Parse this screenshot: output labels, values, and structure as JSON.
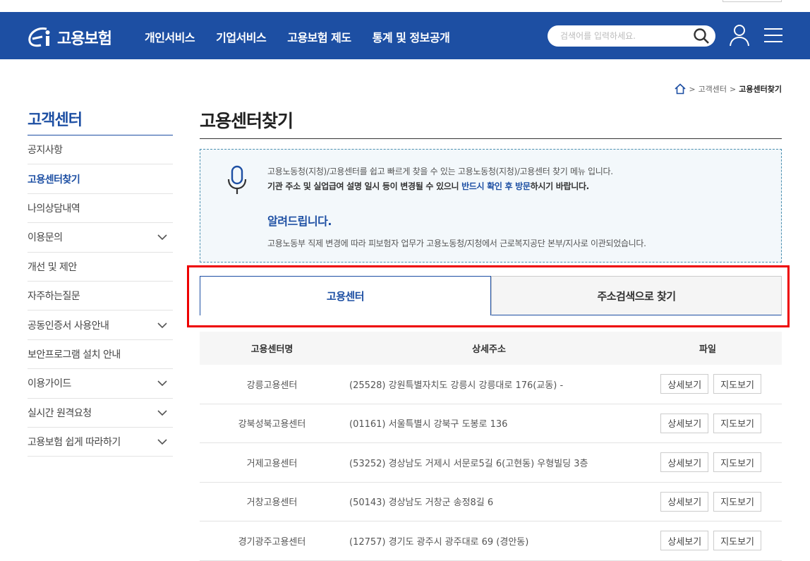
{
  "header": {
    "logo_text": "고용보험",
    "nav": [
      "개인서비스",
      "기업서비스",
      "고용보험 제도",
      "통계 및 정보공개"
    ],
    "search_placeholder": "검색어를 입력하세요.",
    "brand_color": "#1d4fa3"
  },
  "breadcrumb": {
    "items": [
      "고객센터",
      "고용센터찾기"
    ]
  },
  "sidebar": {
    "title": "고객센터",
    "items": [
      {
        "label": "공지사항",
        "expandable": false,
        "active": false
      },
      {
        "label": "고용센터찾기",
        "expandable": false,
        "active": true
      },
      {
        "label": "나의상담내역",
        "expandable": false,
        "active": false
      },
      {
        "label": "이용문의",
        "expandable": true,
        "active": false
      },
      {
        "label": "개선 및 제안",
        "expandable": false,
        "active": false
      },
      {
        "label": "자주하는질문",
        "expandable": false,
        "active": false
      },
      {
        "label": "공동인증서 사용안내",
        "expandable": true,
        "active": false
      },
      {
        "label": "보안프로그램 설치 안내",
        "expandable": false,
        "active": false
      },
      {
        "label": "이용가이드",
        "expandable": true,
        "active": false
      },
      {
        "label": "실시간 원격요청",
        "expandable": true,
        "active": false
      },
      {
        "label": "고용보험 쉽게 따라하기",
        "expandable": true,
        "active": false
      }
    ]
  },
  "main": {
    "title": "고용센터찾기",
    "notice": {
      "line1": "고용노동청(지청)/고용센터를 쉽고 빠르게 찾을 수 있는 고용노동청(지청)/고용센터 찾기 메뉴 입니다.",
      "line2_pre": "기관 주소 및 실업급여 설명 일시 등이 변경될 수 있으니 ",
      "line2_hl": "반드시 확인 후 방문",
      "line2_post": "하시기 바랍니다.",
      "heading": "알려드립니다.",
      "line3": "고용노동부 직제 변경에 따라 피보험자 업무가 고용노동청/지청에서 근로복지공단 본부/지사로 이관되었습니다."
    },
    "tabs": [
      {
        "label": "고용센터",
        "selected": true
      },
      {
        "label": "주소검색으로 찾기",
        "selected": false
      }
    ],
    "table": {
      "headers": [
        "고용센터명",
        "상세주소",
        "파일"
      ],
      "detail_label": "상세보기",
      "map_label": "지도보기",
      "rows": [
        {
          "name": "강릉고용센터",
          "address": "(25528) 강원특별자치도 강릉시 강릉대로 176(교동) -"
        },
        {
          "name": "강북성북고용센터",
          "address": "(01161) 서울특별시 강북구 도봉로 136"
        },
        {
          "name": "거제고용센터",
          "address": "(53252) 경상남도 거제시 서문로5길 6(고현동) 우형빌딩 3층"
        },
        {
          "name": "거창고용센터",
          "address": "(50143) 경상남도 거창군 송정8길 6"
        },
        {
          "name": "경기광주고용센터",
          "address": "(12757) 경기도 광주시 광주대로 69 (경안동)"
        }
      ]
    }
  }
}
